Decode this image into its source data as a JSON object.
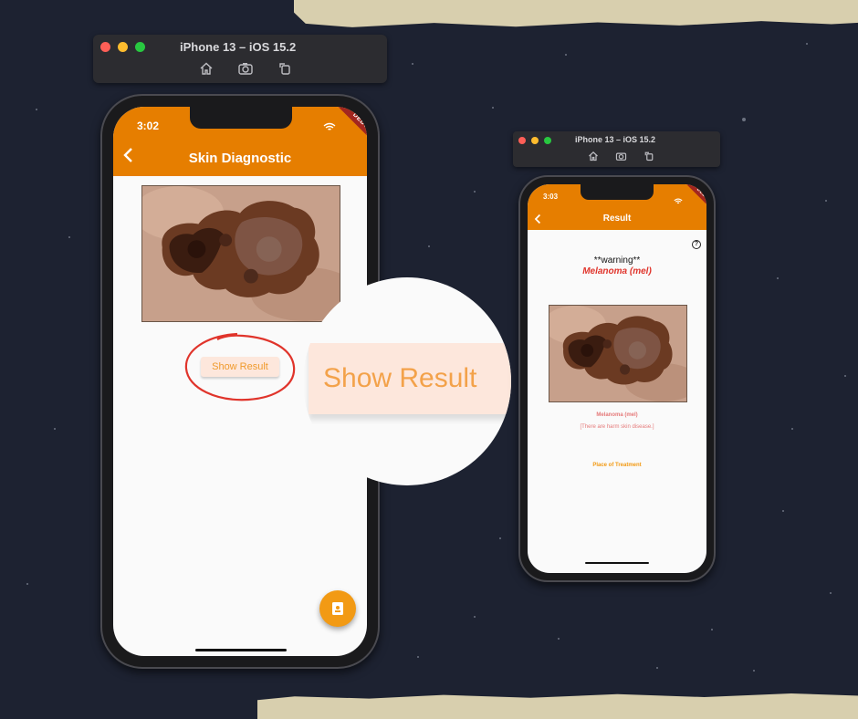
{
  "left_sim": {
    "title": "iPhone 13 – iOS 15.2",
    "status_time": "3:02",
    "appbar_title": "Skin Diagnostic",
    "debug_label": "DEBUG",
    "show_result_label": "Show Result",
    "fab_icon": "contact-card-icon"
  },
  "zoom": {
    "label": "Show Result"
  },
  "right_sim": {
    "title": "iPhone 13 – iOS 15.2",
    "status_time": "3:03",
    "appbar_title": "Result",
    "debug_label": "DEBUG",
    "warning": "**warning**",
    "diagnosis": "Melanoma (mel)",
    "caption_name": "Melanoma (mel)",
    "caption_note": "[There are harm skin disease.]",
    "place_link": "Place of Treatment"
  },
  "colors": {
    "appbar": "#e67e00",
    "background": "#1d2231",
    "paper": "#d8cfae",
    "accent_orange": "#f29a14",
    "warning_red": "#e0342b"
  }
}
